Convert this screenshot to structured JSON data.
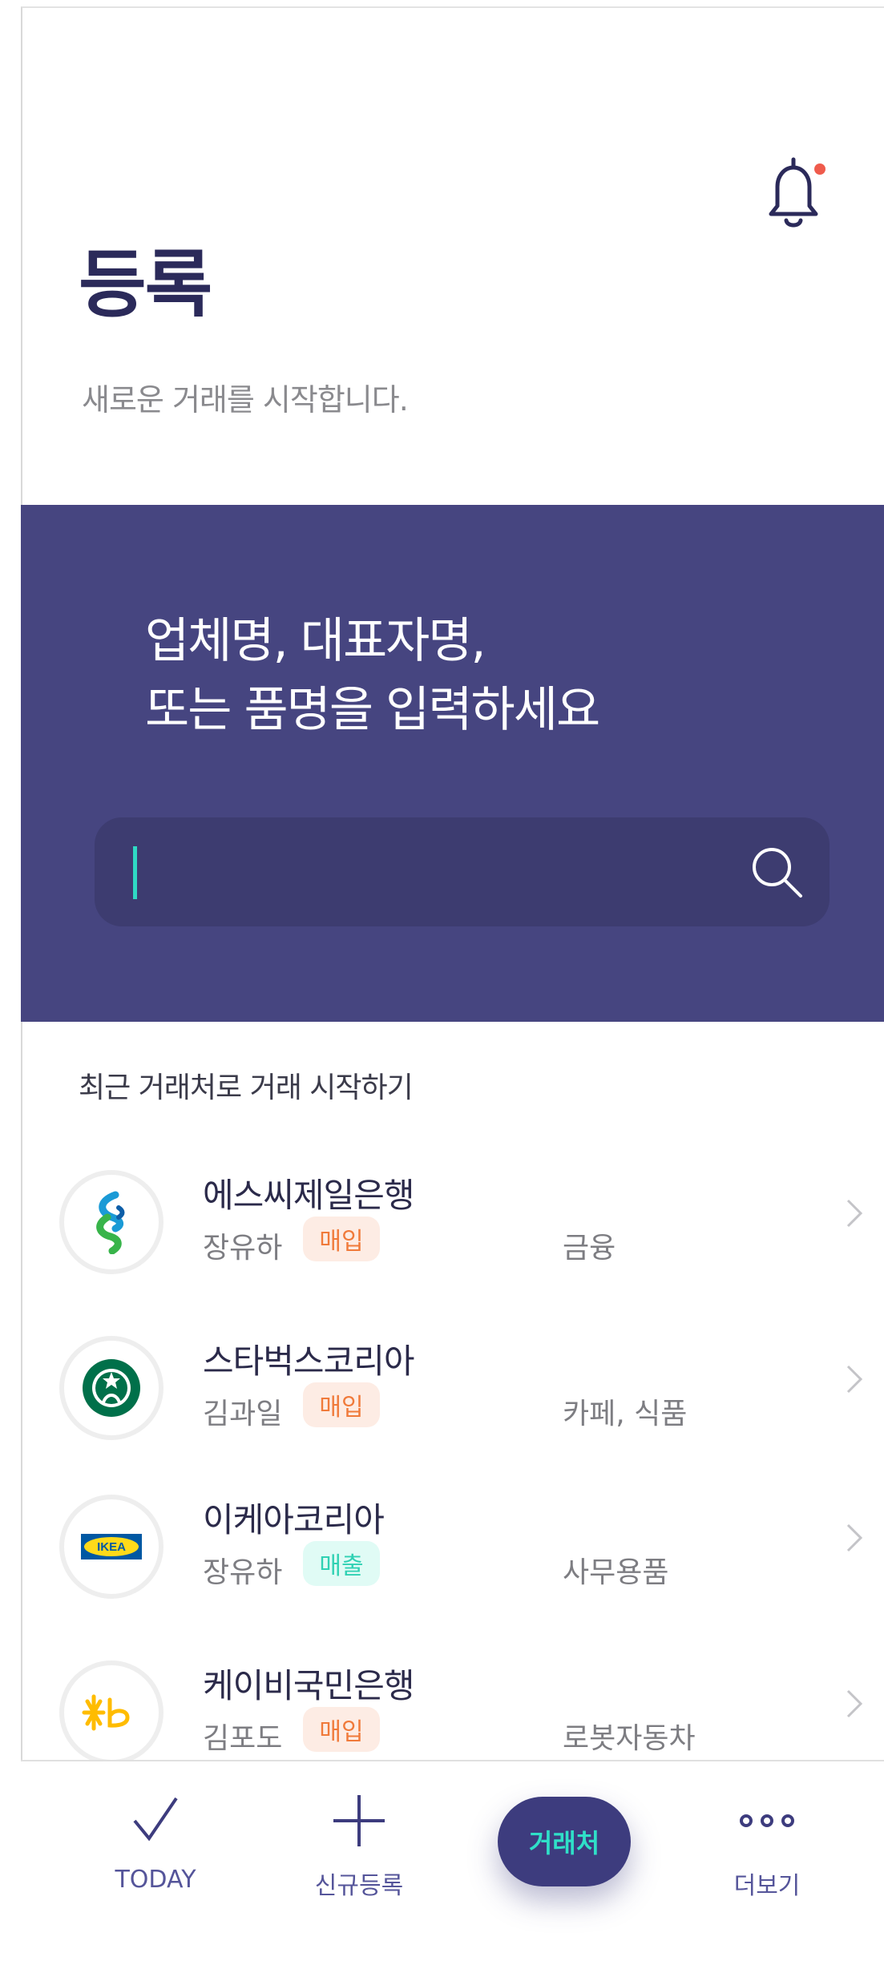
{
  "header": {
    "title": "등록",
    "subtitle": "새로운 거래를 시작합니다."
  },
  "search": {
    "prompt_line1": "업체명, 대표자명,",
    "prompt_line2": "또는 품명을 입력하세요",
    "value": ""
  },
  "recent": {
    "label": "최근 거래처로 거래 시작하기",
    "items": [
      {
        "name": "에스씨제일은행",
        "person": "장유하",
        "badge": "매입",
        "badge_type": "buy",
        "category": "금융",
        "logo": "standard-chartered-logo"
      },
      {
        "name": "스타벅스코리아",
        "person": "김과일",
        "badge": "매입",
        "badge_type": "buy",
        "category": "카페, 식품",
        "logo": "starbucks-logo"
      },
      {
        "name": "이케아코리아",
        "person": "장유하",
        "badge": "매출",
        "badge_type": "sell",
        "category": "사무용품",
        "logo": "ikea-logo"
      },
      {
        "name": "케이비국민은행",
        "person": "김포도",
        "badge": "매입",
        "badge_type": "buy",
        "category": "로봇자동차",
        "logo": "kb-logo"
      }
    ]
  },
  "tabbar": {
    "today": "TODAY",
    "new": "신규등록",
    "partners": "거래처",
    "more": "더보기"
  },
  "colors": {
    "brand": "#464580",
    "accent": "#2fd9c4",
    "buy": "#f07a3a",
    "sell": "#2fd1b3"
  }
}
